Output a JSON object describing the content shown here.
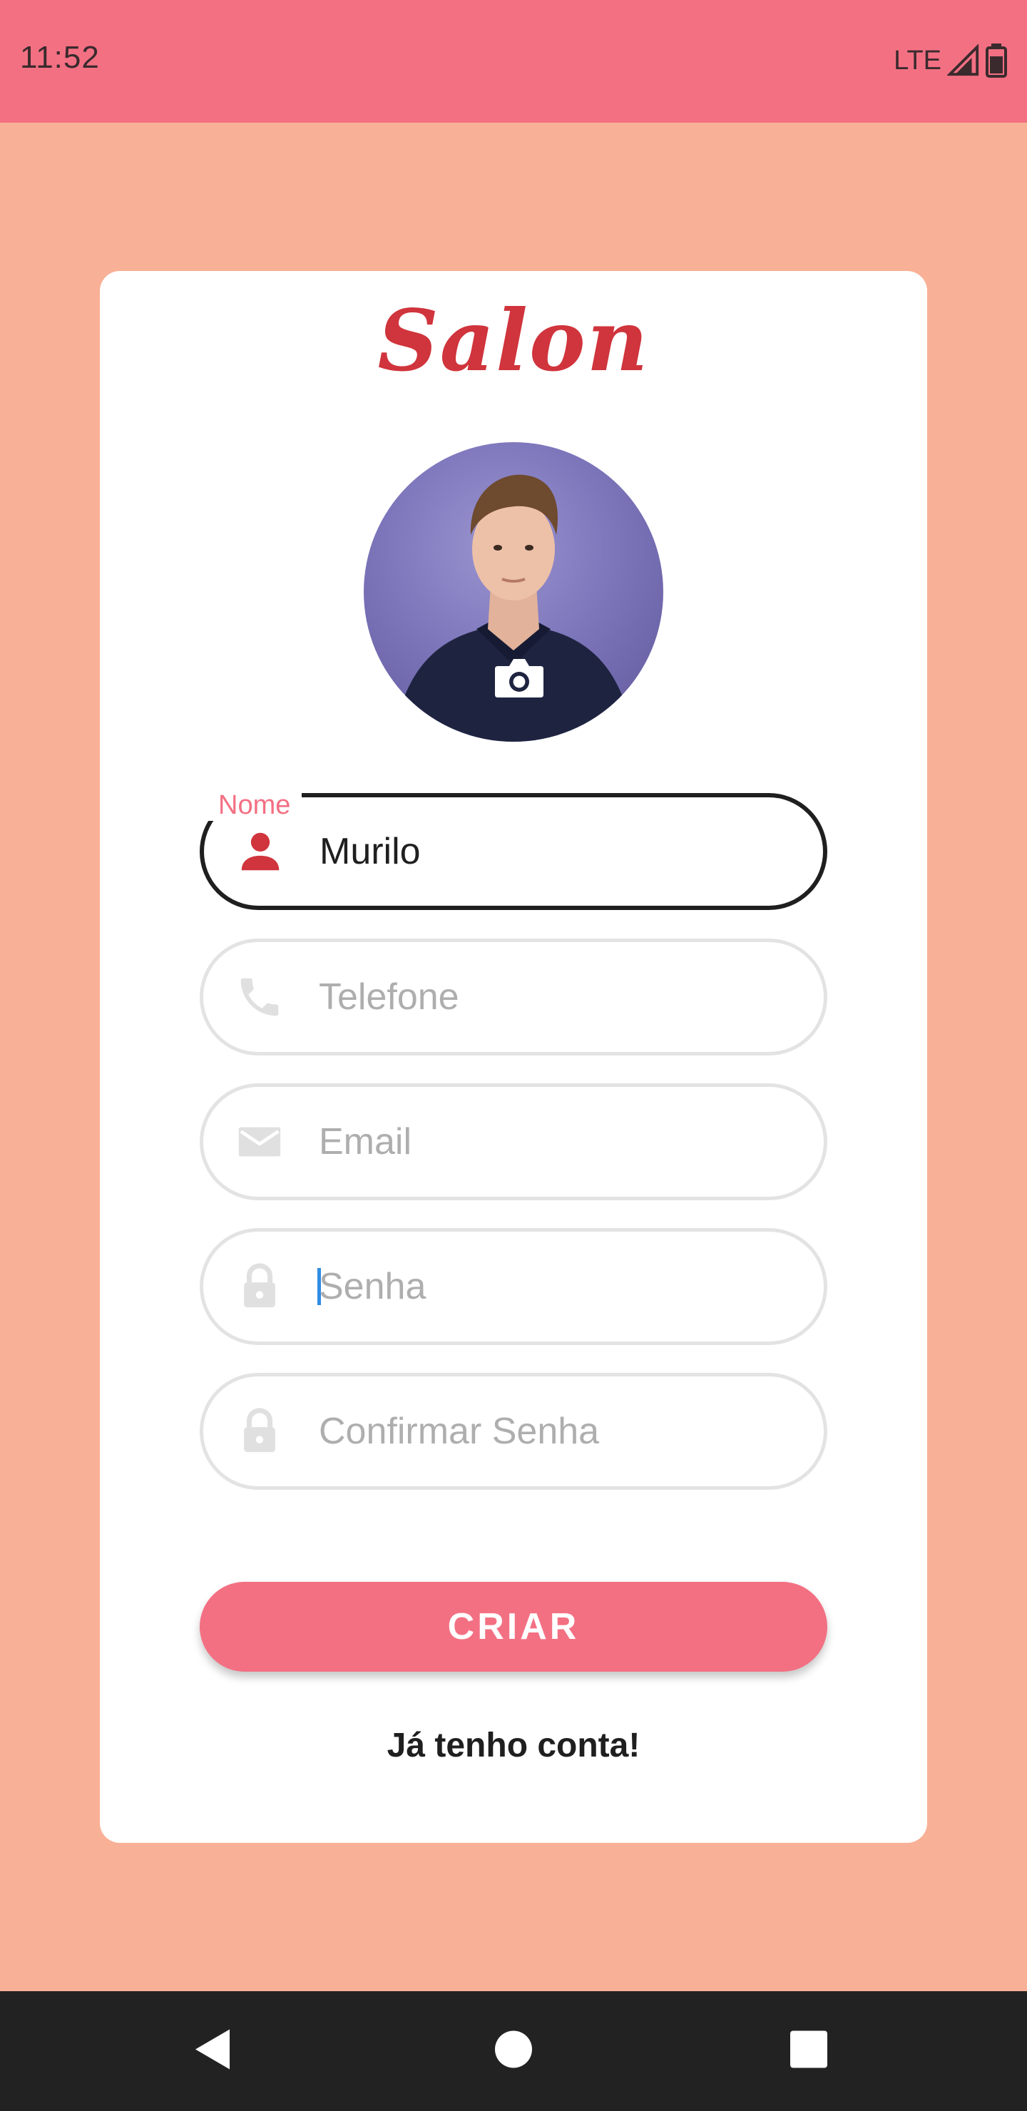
{
  "status_bar": {
    "time": "11:52",
    "network": "LTE",
    "icons": [
      "signal-icon",
      "battery-icon"
    ],
    "background": "#F37083"
  },
  "app": {
    "brand": "Salon",
    "brand_color": "#D0343C",
    "background": "#F8B196"
  },
  "profile": {
    "avatar": "profile-photo",
    "change_photo_icon": "camera-icon"
  },
  "form": {
    "name": {
      "label": "Nome",
      "value": "Murilo",
      "icon": "person-icon",
      "focused": true
    },
    "phone": {
      "placeholder": "Telefone",
      "icon": "phone-icon"
    },
    "email": {
      "placeholder": "Email",
      "icon": "mail-icon"
    },
    "password": {
      "placeholder": "Senha",
      "icon": "lock-icon"
    },
    "confirm_password": {
      "placeholder": "Confirmar Senha",
      "icon": "lock-icon"
    }
  },
  "actions": {
    "create_label": "CRIAR",
    "create_color": "#F37083",
    "login_link": "Já tenho conta!"
  },
  "nav_bar": {
    "buttons": [
      "back-icon",
      "home-icon",
      "recents-icon"
    ]
  }
}
